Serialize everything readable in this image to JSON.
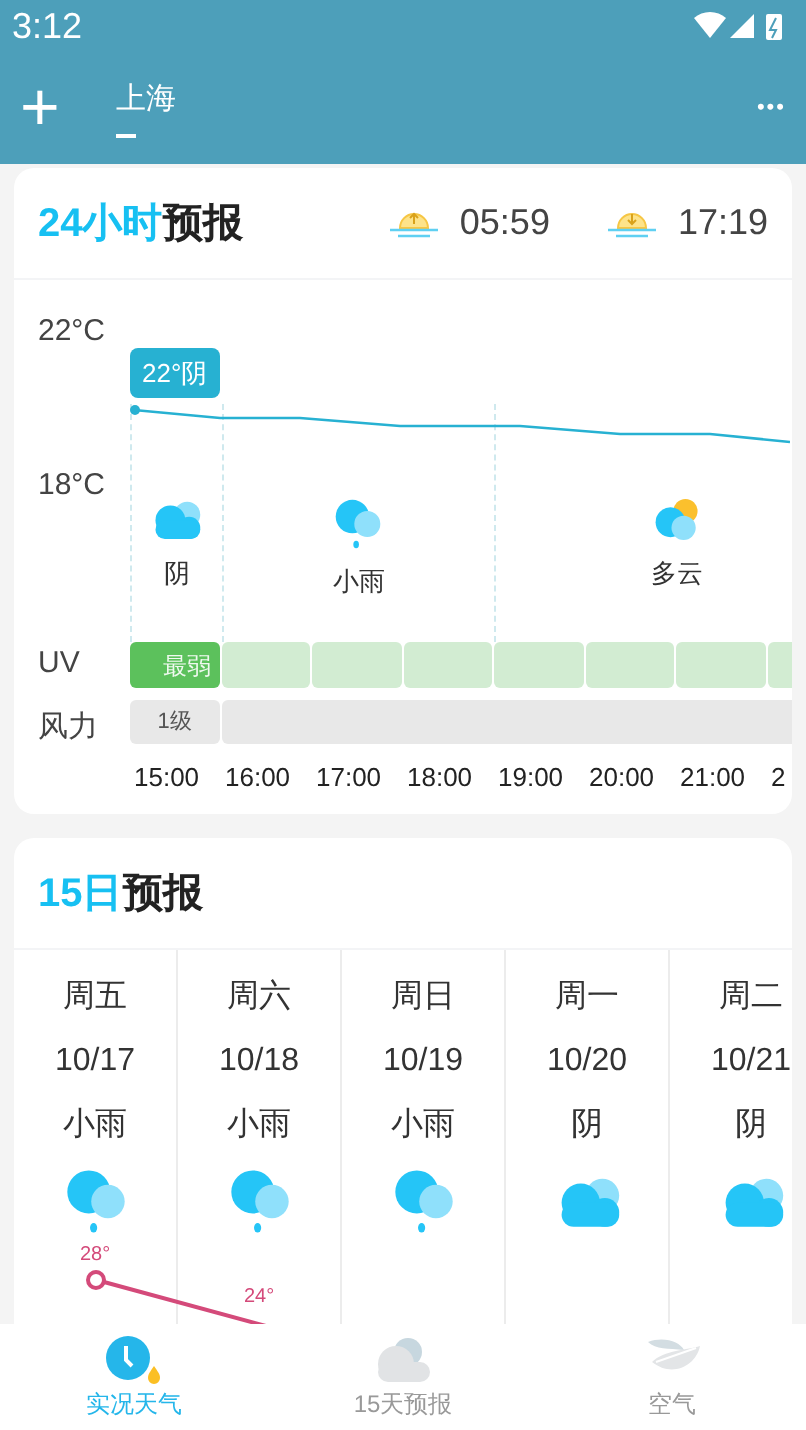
{
  "status_bar": {
    "time": "3:12"
  },
  "toolbar": {
    "add": "+",
    "tabs": [
      {
        "label": "上海",
        "selected": true
      }
    ],
    "more": "•••"
  },
  "hourly": {
    "title_accent": "24小时",
    "title": "预报",
    "sunrise": "05:59",
    "sunset": "17:19",
    "y_labels": [
      "22°C",
      "18°C"
    ],
    "tag": "22°阴",
    "groups": [
      {
        "kind": "overcast",
        "label": "阴"
      },
      {
        "kind": "rain",
        "label": "小雨"
      },
      {
        "kind": "partly-cloudy",
        "label": "多云"
      }
    ],
    "uv_label": "UV",
    "uv": [
      {
        "label": "最弱",
        "strong": true
      },
      {
        "strong": false
      },
      {
        "strong": false
      },
      {
        "strong": false
      },
      {
        "strong": false
      },
      {
        "strong": false
      },
      {
        "strong": false
      },
      {
        "strong": false
      }
    ],
    "wind_label": "风力",
    "wind": {
      "label": "1级"
    },
    "hours": [
      "15:00",
      "16:00",
      "17:00",
      "18:00",
      "19:00",
      "20:00",
      "21:00",
      "2"
    ]
  },
  "daily": {
    "title_accent": "15日",
    "title": "预报",
    "days": [
      {
        "weekday": "周五",
        "date": "10/17",
        "weather": "小雨",
        "kind": "rain",
        "high": "28°"
      },
      {
        "weekday": "周六",
        "date": "10/18",
        "weather": "小雨",
        "kind": "rain",
        "high": "24°"
      },
      {
        "weekday": "周日",
        "date": "10/19",
        "weather": "小雨",
        "kind": "rain"
      },
      {
        "weekday": "周一",
        "date": "10/20",
        "weather": "阴",
        "kind": "overcast"
      },
      {
        "weekday": "周二",
        "date": "10/21",
        "weather": "阴",
        "kind": "overcast"
      }
    ]
  },
  "bottom_nav": [
    {
      "label": "实况天气",
      "kind": "live",
      "selected": true
    },
    {
      "label": "15天预报",
      "kind": "forecast",
      "selected": false
    },
    {
      "label": "空气",
      "kind": "air",
      "selected": false
    }
  ]
}
